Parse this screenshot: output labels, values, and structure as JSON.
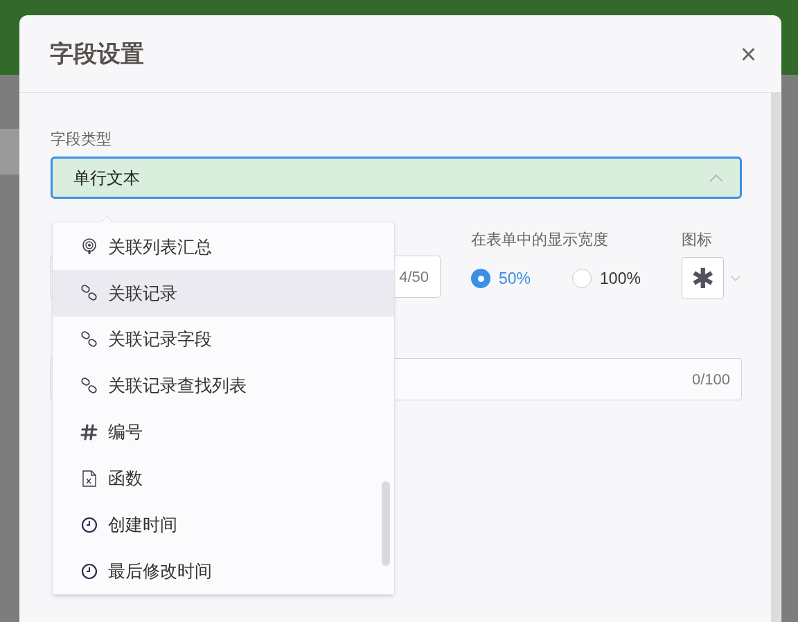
{
  "dialog": {
    "title": "字段设置",
    "close": "×"
  },
  "field_type": {
    "label": "字段类型",
    "value": "单行文本",
    "expanded": true
  },
  "name_input": {
    "counter": "4/50"
  },
  "display_width": {
    "label": "在表单中的显示宽度",
    "options": [
      {
        "label": "50%",
        "selected": true
      },
      {
        "label": "100%",
        "selected": false
      }
    ]
  },
  "icon_picker": {
    "label": "图标",
    "value": "✱"
  },
  "description_input": {
    "counter": "0/100"
  },
  "dropdown": {
    "items": [
      {
        "kind": "summary",
        "label": "关联列表汇总",
        "selected": false
      },
      {
        "kind": "link",
        "label": "关联记录",
        "selected": true
      },
      {
        "kind": "link",
        "label": "关联记录字段",
        "selected": false
      },
      {
        "kind": "link",
        "label": "关联记录查找列表",
        "selected": false
      },
      {
        "kind": "hash",
        "label": "编号",
        "selected": false
      },
      {
        "kind": "formula",
        "label": "函数",
        "selected": false
      },
      {
        "kind": "clock",
        "label": "创建时间",
        "selected": false
      },
      {
        "kind": "clock",
        "label": "最后修改时间",
        "selected": false
      }
    ]
  }
}
